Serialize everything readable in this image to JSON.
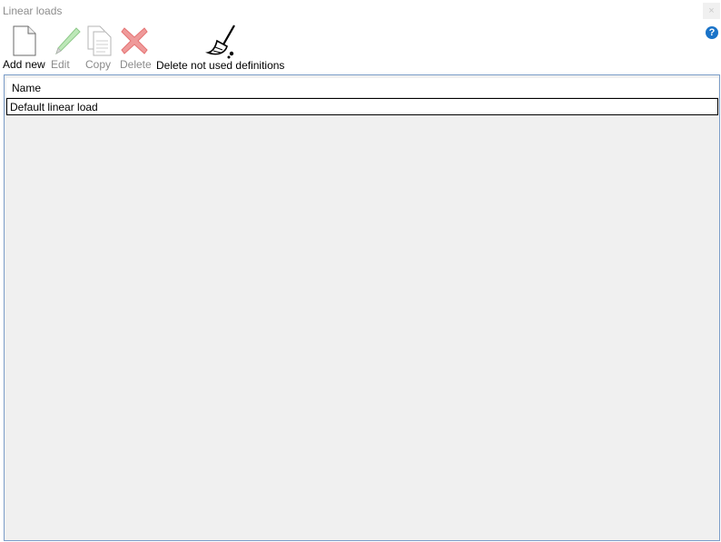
{
  "window": {
    "title": "Linear loads",
    "close_glyph": "×",
    "help_glyph": "?"
  },
  "toolbar": {
    "add_new": {
      "label": "Add new",
      "icon": "new-document-icon"
    },
    "edit": {
      "label": "Edit",
      "icon": "pencil-icon"
    },
    "copy": {
      "label": "Copy",
      "icon": "copy-document-icon"
    },
    "delete": {
      "label": "Delete",
      "icon": "red-x-icon"
    },
    "delete_unused": {
      "label": "Delete not used definitions",
      "icon": "broom-icon"
    }
  },
  "grid": {
    "columns": [
      "Name"
    ],
    "rows": [
      {
        "name": "Default linear load"
      }
    ]
  },
  "colors": {
    "help": "#1a73c8",
    "delete": "#e04848",
    "edit": "#8fd18c",
    "border": "#7a9cc8"
  }
}
